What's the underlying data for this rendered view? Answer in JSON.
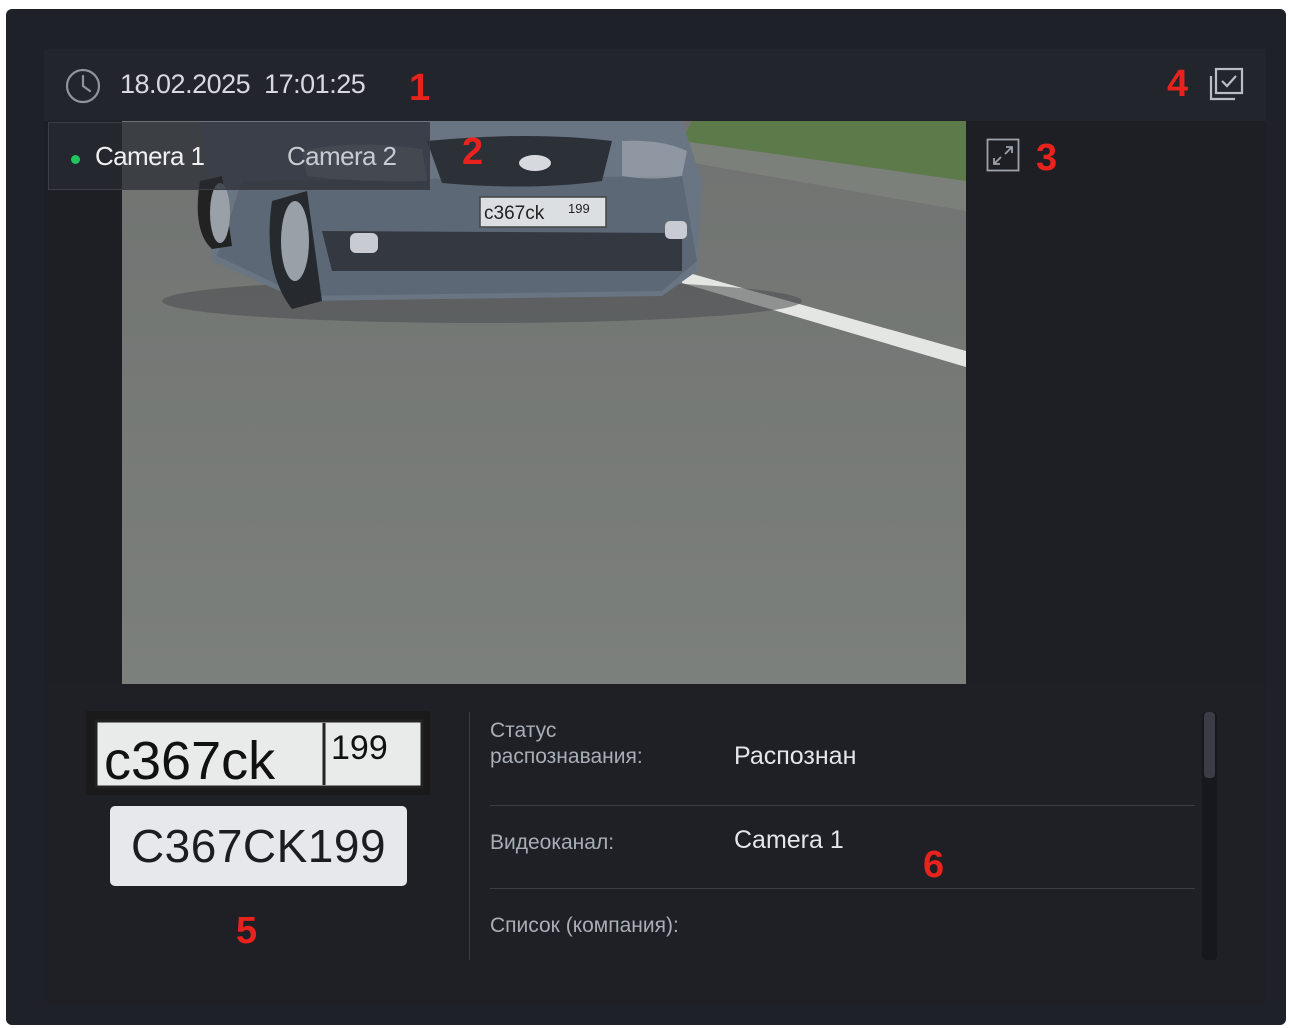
{
  "header": {
    "datetime": "18.02.2025  17:01:25",
    "clock_icon": "clock-icon",
    "report_icon": "checkbox-report-icon"
  },
  "camera_tabs": [
    {
      "label": "Camera 1",
      "active": true
    },
    {
      "label": "Camera 2",
      "active": false
    }
  ],
  "video": {
    "plate_in_scene": "c367ck 199",
    "expand_icon": "expand-icon"
  },
  "plate": {
    "image_text": "c367ck",
    "image_region": "199",
    "recognized_number": "C367CK199"
  },
  "info": {
    "status_label": "Статус распознавания:",
    "status_value": "Распознан",
    "channel_label": "Видеоканал:",
    "channel_value": "Camera 1",
    "list_label": "Список (компания):",
    "list_value": ""
  },
  "markers": [
    "1",
    "2",
    "3",
    "4",
    "5",
    "6"
  ],
  "colors": {
    "background": "#1f2128",
    "live_indicator": "#22c55e",
    "marker": "#e8231d"
  }
}
